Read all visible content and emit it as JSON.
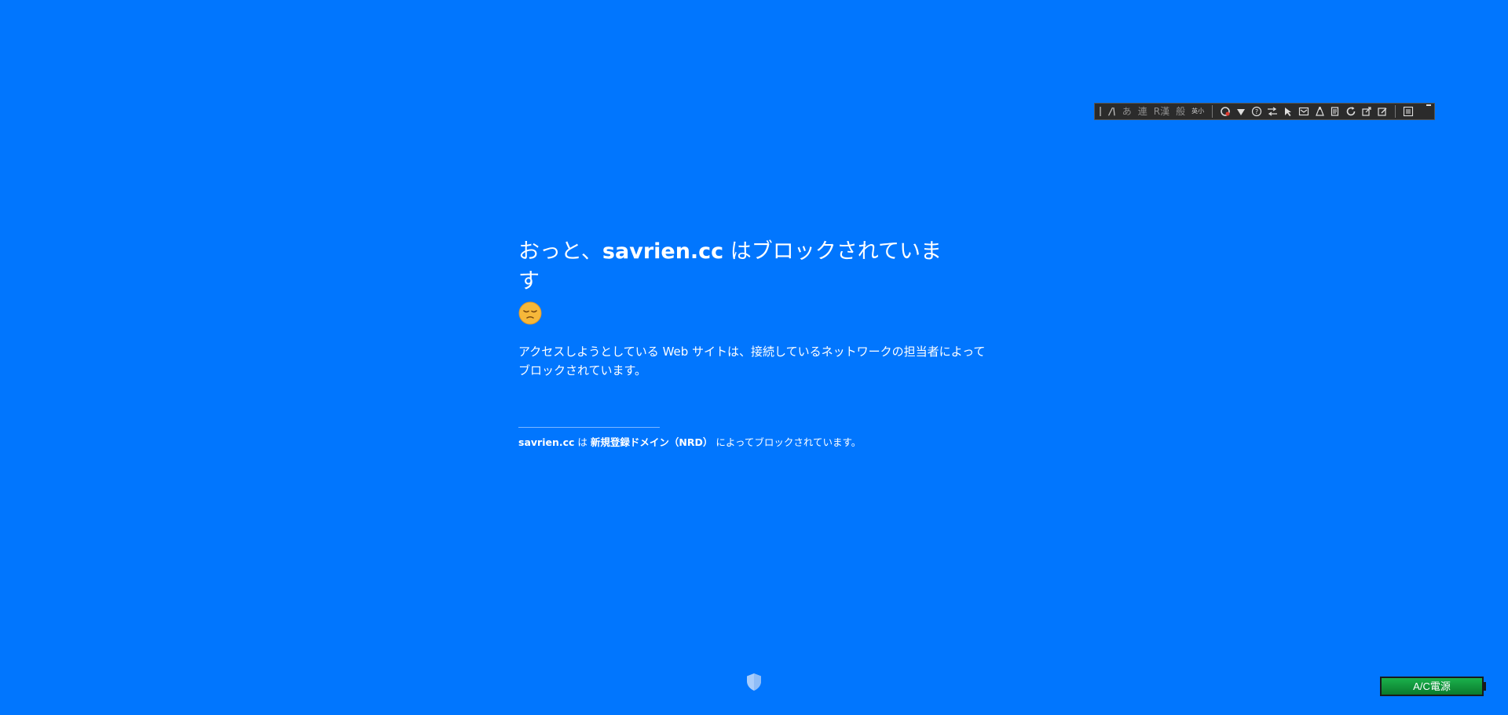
{
  "ime_toolbar": {
    "modes": [
      "あ",
      "連",
      "R漢",
      "般",
      "英小"
    ],
    "icons": [
      "settings-icon",
      "handwriting-icon",
      "help-icon",
      "conversion-icon",
      "pointer-icon",
      "dictionary-icon",
      "clean-icon",
      "notes-icon",
      "refresh-icon",
      "export-icon",
      "edit-icon",
      "menu-icon"
    ]
  },
  "block_page": {
    "headline_prefix": "おっと、",
    "domain": "savrien.cc",
    "headline_suffix": " はブロックされています",
    "description": "アクセスしようとしている Web サイトは、接続しているネットワークの担当者によってブロックされています。",
    "reason_domain": "savrien.cc",
    "reason_particle": " は ",
    "reason_category": "新規登録ドメイン（NRD）",
    "reason_suffix": " によってブロックされています。"
  },
  "power_badge": {
    "label": "A/C電源"
  },
  "colors": {
    "background": "#0176fe",
    "power_green": "#0f8f3a"
  }
}
